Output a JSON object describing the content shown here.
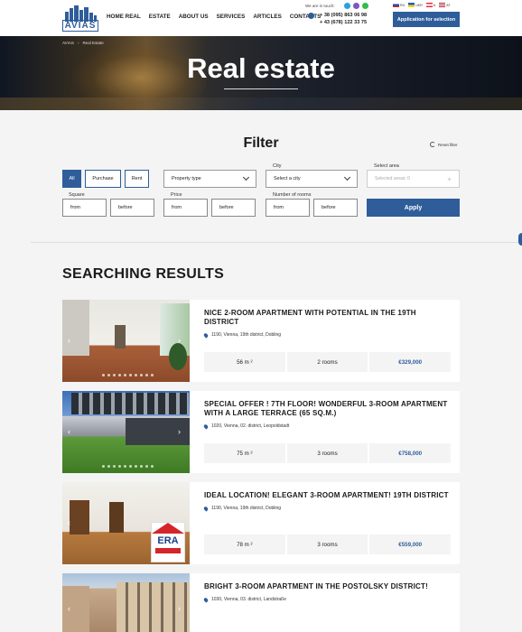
{
  "header": {
    "logo_text": "AVIAS",
    "nav": [
      "HOME REAL",
      "ESTATE",
      "ABOUT US",
      "SERVICES",
      "ARTICLES",
      "CONTACTS"
    ],
    "contact_label": "We are in touch:",
    "messengers": [
      {
        "icon": "telegram-icon",
        "color": "#2aa3dc"
      },
      {
        "icon": "viber-icon",
        "color": "#7b59c4"
      },
      {
        "icon": "whatsapp-icon",
        "color": "#2fbf4a"
      }
    ],
    "phones": [
      "+ 38 (095) 863 06 98",
      "+ 43 (678) 122 33 75"
    ],
    "languages": [
      {
        "code": "RU",
        "colors": [
          "#ffffff",
          "#1a47b8",
          "#d52b1e"
        ]
      },
      {
        "code": "UKR",
        "colors": [
          "#1a5fd0",
          "#ffd500"
        ]
      },
      {
        "code": "A",
        "colors": [
          "#ed2939",
          "#ffffff",
          "#ed2939"
        ]
      },
      {
        "code": "AT",
        "colors": [
          "#b22234",
          "#ffffff",
          "#3c3b6e"
        ]
      }
    ],
    "cta": "Application for selection",
    "accent": "#2e5d9a"
  },
  "hero": {
    "breadcrumb": [
      "AVIAS",
      "Real Estate"
    ],
    "title": "Real estate"
  },
  "filter": {
    "title": "Filter",
    "reset": "Reset filter",
    "deal_types": [
      {
        "label": "All",
        "active": true
      },
      {
        "label": "Purchase",
        "active": false
      },
      {
        "label": "Rent",
        "active": false
      }
    ],
    "property_type": "Property type",
    "city_label": "City",
    "city_value": "Select a city",
    "area_label": "Select area",
    "area_placeholder": "Selected areas: 0",
    "square_label": "Square",
    "price_label": "Price",
    "rooms_label": "Number of rooms",
    "from": "from",
    "before": "before",
    "apply": "Apply"
  },
  "results": {
    "title": "SEARCHING RESULTS",
    "items": [
      {
        "title": "NICE 2-ROOM APARTMENT WITH POTENTIAL IN THE 19TH DISTRICT",
        "address": "1190, Vienna, 19th district, Dobling",
        "area": "56 m ²",
        "rooms": "2 rooms",
        "price": "€329,000"
      },
      {
        "title": "SPECIAL OFFER ! 7TH FLOOR! WONDERFUL 3-ROOM APARTMENT WITH A LARGE TERRACE (65 SQ.M.)",
        "address": "1020, Vienna, 02. district, Leopoldstadt",
        "area": "75 m ²",
        "rooms": "3 rooms",
        "price": "€758,000"
      },
      {
        "title": "IDEAL LOCATION! ELEGANT 3-ROOM APARTMENT! 19TH DISTRICT",
        "address": "1190, Vienna, 19th district, Dobling",
        "area": "78 m ²",
        "rooms": "3 rooms",
        "price": "€559,000",
        "badge": "ERA"
      },
      {
        "title": "BRIGHT 3-ROOM APARTMENT IN THE POSTOLSKY DISTRICT!",
        "address": "1030, Vienna, 03. district, Landstraße"
      }
    ]
  }
}
